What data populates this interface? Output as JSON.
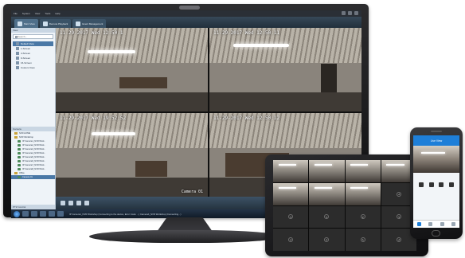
{
  "app": {
    "title": "NVR Client",
    "menu": [
      "File",
      "System",
      "View",
      "Tools",
      "Help"
    ],
    "tabs": [
      {
        "label": "Main View"
      },
      {
        "label": "Remote Playback"
      },
      {
        "label": "Event Management"
      }
    ],
    "left_panel": {
      "view_header": "View",
      "search_placeholder": "Search...",
      "views": [
        "Default View",
        "1-Screen",
        "4-Screen",
        "9-Screen",
        "16-Screen",
        "Custom View"
      ],
      "camera_header": "Camera",
      "devices": [
        {
          "label": "NVR-HOME",
          "type": "folder"
        },
        {
          "label": "NVR Workshop",
          "type": "folder"
        },
        {
          "label": "IP Camera1_NVR Work..",
          "type": "camera"
        },
        {
          "label": "IP Camera2_NVR Work..",
          "type": "camera"
        },
        {
          "label": "IP Camera3_NVR Work..",
          "type": "camera"
        },
        {
          "label": "IP Camera4_NVR Work..",
          "type": "camera"
        },
        {
          "label": "IP Camera5_NVR Work..",
          "type": "camera"
        },
        {
          "label": "IP Camera6_NVR Work..",
          "type": "camera"
        },
        {
          "label": "IP Camera7_NVR Work..",
          "type": "camera"
        },
        {
          "label": "IP Camera8_NVR Work..",
          "type": "camera"
        },
        {
          "label": "Office",
          "type": "folder"
        },
        {
          "label": "Camera 01",
          "type": "camera"
        }
      ],
      "ptz_header": "PTZ Control"
    },
    "tiles": [
      {
        "osd": "11-29-2017 Wed 12:50:1",
        "name": ""
      },
      {
        "osd": "11-29-2017 Wed 12:50:11",
        "name": ""
      },
      {
        "osd": "11-29-2017 Wed 19:52:52",
        "name": "Camera 01"
      },
      {
        "osd": "11-29-2017 Wed 12:50:12",
        "name": ""
      }
    ],
    "taskbar_status": "IP Camera1_NVR Workshop (Connecting to the device, Error Code: ...) Camera4_NVR Workshop (Connecting...)"
  },
  "tablet": {
    "video_cells": 7,
    "empty_cells": 9
  },
  "phone": {
    "nav_title": "Live View"
  },
  "colors": {
    "accent": "#4a78a6",
    "phone_accent": "#1e7fd8"
  }
}
